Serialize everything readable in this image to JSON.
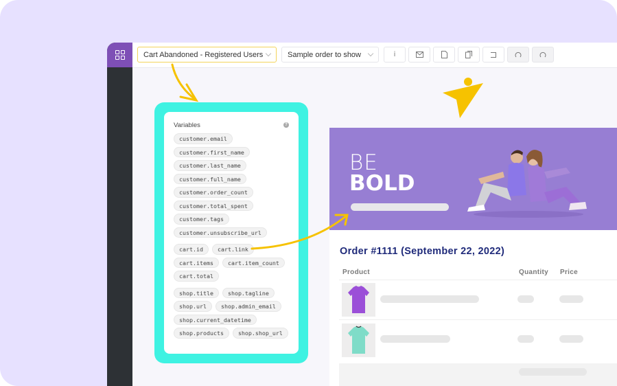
{
  "toolbar": {
    "template_select": "Cart Abandoned - Registered Users",
    "order_select": "Sample order to show",
    "buttons": [
      {
        "name": "info-button",
        "icon": "i",
        "label": "Info"
      },
      {
        "name": "send-email-button",
        "icon": "envelope",
        "label": "Send test email"
      },
      {
        "name": "document-button",
        "icon": "document",
        "label": "Document"
      },
      {
        "name": "duplicate-button",
        "icon": "copy",
        "label": "Duplicate"
      },
      {
        "name": "exit-button",
        "icon": "exit",
        "label": "Exit"
      },
      {
        "name": "undo-button",
        "icon": "undo",
        "label": "Undo"
      },
      {
        "name": "redo-button",
        "icon": "redo",
        "label": "Redo"
      }
    ]
  },
  "variables": {
    "title": "Variables",
    "help_icon": "?",
    "groups": [
      [
        "customer.email",
        "customer.first_name",
        "customer.last_name",
        "customer.full_name",
        "customer.order_count",
        "customer.total_spent",
        "customer.tags",
        "customer.unsubscribe_url"
      ],
      [
        "cart.id",
        "cart.link",
        "cart.items",
        "cart.item_count",
        "cart.total"
      ],
      [
        "shop.title",
        "shop.tagline",
        "shop.url",
        "shop.admin_email",
        "shop.current_datetime",
        "shop.products",
        "shop.shop_url"
      ]
    ]
  },
  "preview": {
    "hero_line1": "BE",
    "hero_line2": "BOLD",
    "hero_color": "#977ed3",
    "order_title": "Order #1111 (September 22, 2022)",
    "columns": [
      "Product",
      "Quantity",
      "Price"
    ],
    "items": [
      {
        "product_color": "#9b4fd8"
      },
      {
        "product_color": "#7fdcc8"
      }
    ]
  },
  "colors": {
    "accent_purple": "#7e4fb6",
    "highlight_cyan": "#3ff2e2",
    "arrow_yellow": "#f6c200",
    "title_navy": "#1f2a7a"
  }
}
